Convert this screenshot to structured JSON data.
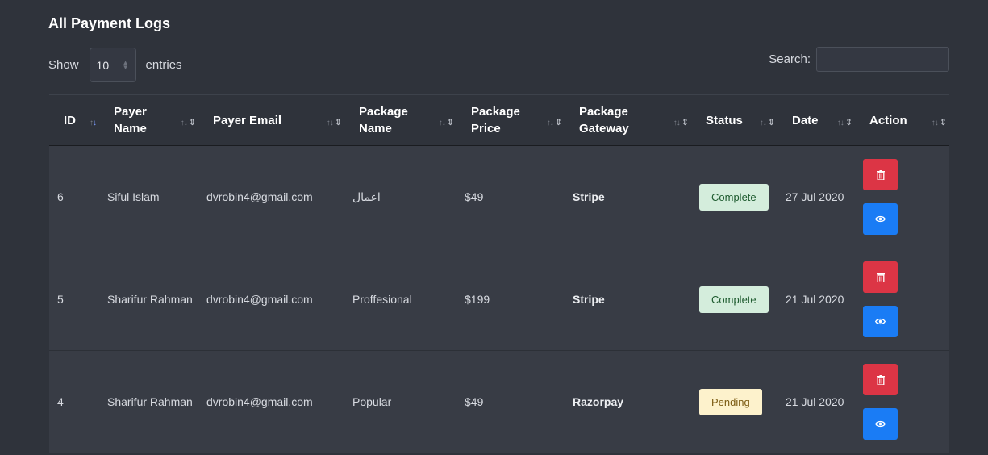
{
  "page": {
    "title": "All Payment Logs"
  },
  "length": {
    "show_label": "Show",
    "selected": "10",
    "entries_label": "entries"
  },
  "search": {
    "label": "Search:",
    "value": "",
    "placeholder": ""
  },
  "table": {
    "headers": [
      {
        "line1": "ID",
        "line2": ""
      },
      {
        "line1": "Payer",
        "line2": "Name"
      },
      {
        "line1": "Payer Email",
        "line2": ""
      },
      {
        "line1": "Package",
        "line2": "Name"
      },
      {
        "line1": "Package",
        "line2": "Price"
      },
      {
        "line1": "Package",
        "line2": "Gateway"
      },
      {
        "line1": "Status",
        "line2": ""
      },
      {
        "line1": "Date",
        "line2": ""
      },
      {
        "line1": "Action",
        "line2": ""
      }
    ],
    "rows": [
      {
        "id": "6",
        "name": "Siful Islam",
        "email": "dvrobin4@gmail.com",
        "package": "اعمال",
        "price": "$49",
        "gateway": "Stripe",
        "status": "Complete",
        "date": "27 Jul 2020"
      },
      {
        "id": "5",
        "name": "Sharifur Rahman",
        "email": "dvrobin4@gmail.com",
        "package": "Proffesional",
        "price": "$199",
        "gateway": "Stripe",
        "status": "Complete",
        "date": "21 Jul 2020"
      },
      {
        "id": "4",
        "name": "Sharifur Rahman",
        "email": "dvrobin4@gmail.com",
        "package": "Popular",
        "price": "$49",
        "gateway": "Razorpay",
        "status": "Pending",
        "date": "21 Jul 2020"
      }
    ]
  },
  "icons": {
    "delete": "trash-icon",
    "view": "eye-icon",
    "sort": "sort-arrows-icon"
  },
  "colors": {
    "delete_button": "#dc3545",
    "view_button": "#1a7cf5",
    "complete_badge": "#d4eddc",
    "pending_badge": "#fdf2cc"
  }
}
